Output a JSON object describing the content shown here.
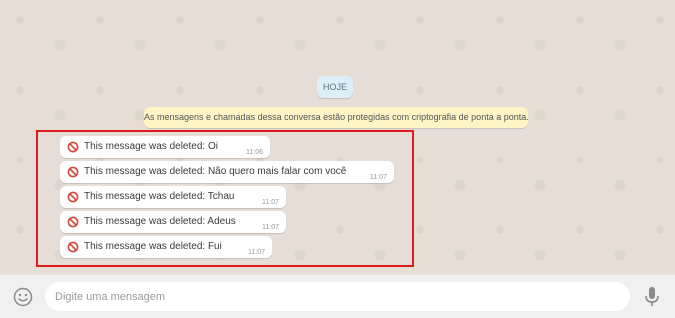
{
  "chat": {
    "date_chip": "HOJE",
    "encryption_notice": "As mensagens e chamadas dessa conversa estão protegidas com criptografia de ponta a ponta.",
    "messages": [
      {
        "text": "This message was deleted: Oi",
        "time": "11:06"
      },
      {
        "text": "This message was deleted: Não quero mais falar com você",
        "time": "11:07"
      },
      {
        "text": "This message was deleted: Tchau",
        "time": "11:07"
      },
      {
        "text": "This message was deleted: Adeus",
        "time": "11:07"
      },
      {
        "text": "This message was deleted: Fui",
        "time": "11:07"
      }
    ],
    "highlight_color": "#e01b1b"
  },
  "composer": {
    "placeholder": "Digite uma mensagem",
    "emoji_icon": "smiley-icon",
    "mic_icon": "microphone-icon"
  }
}
